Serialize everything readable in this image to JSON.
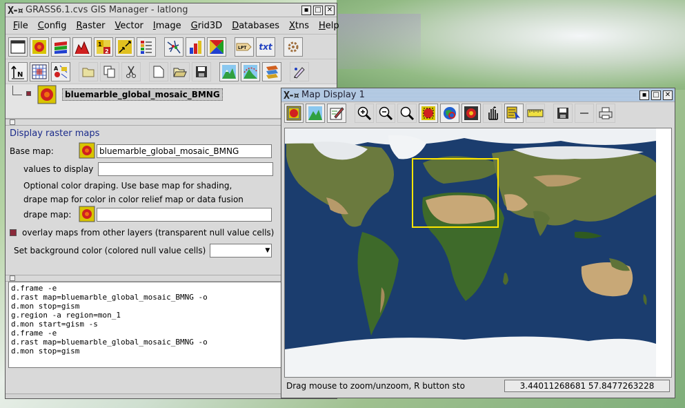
{
  "manager": {
    "title": "GRASS6.1.cvs GIS Manager - latlong",
    "menu": [
      "File",
      "Config",
      "Raster",
      "Vector",
      "Image",
      "Grid3D",
      "Databases",
      "Xtns",
      "Help"
    ],
    "toolbar_glyphs": {
      "text_tool": "txt",
      "legend_tool": "LPT"
    },
    "layer_name": "bluemarble_global_mosaic_BMNG",
    "options": {
      "heading": "Display raster maps",
      "base_label": "Base map:",
      "base_value": "bluemarble_global_mosaic_BMNG",
      "values_label": "values to display",
      "values_value": "",
      "note_line1": "Optional color draping. Use base map for shading,",
      "note_line2": "drape map for color in color relief map or data fusion",
      "drape_label": "drape map:",
      "drape_value": "",
      "overlay_label": "overlay maps from other layers (transparent null value cells)",
      "bg_label": "Set background color (colored null value cells)",
      "bg_value": ""
    },
    "console": "d.frame -e\nd.rast map=bluemarble_global_mosaic_BMNG -o\nd.mon stop=gism\ng.region -a region=mon_1\nd.mon start=gism -s\nd.frame -e\nd.rast map=bluemarble_global_mosaic_BMNG -o\nd.mon stop=gism"
  },
  "map_display": {
    "title": "Map Display 1",
    "status_text": "Drag mouse to zoom/unzoom, R button sto",
    "coordinates": "3.44011268681 57.8477263228"
  },
  "colors": {
    "ocean": "#1b3d6e",
    "land": "#6b7a3e",
    "desert": "#c8a877",
    "ice": "#f2f4f6",
    "zoom_box": "#ffe600",
    "heading": "#1a2a8a",
    "checkbox": "#8a2a3a"
  }
}
